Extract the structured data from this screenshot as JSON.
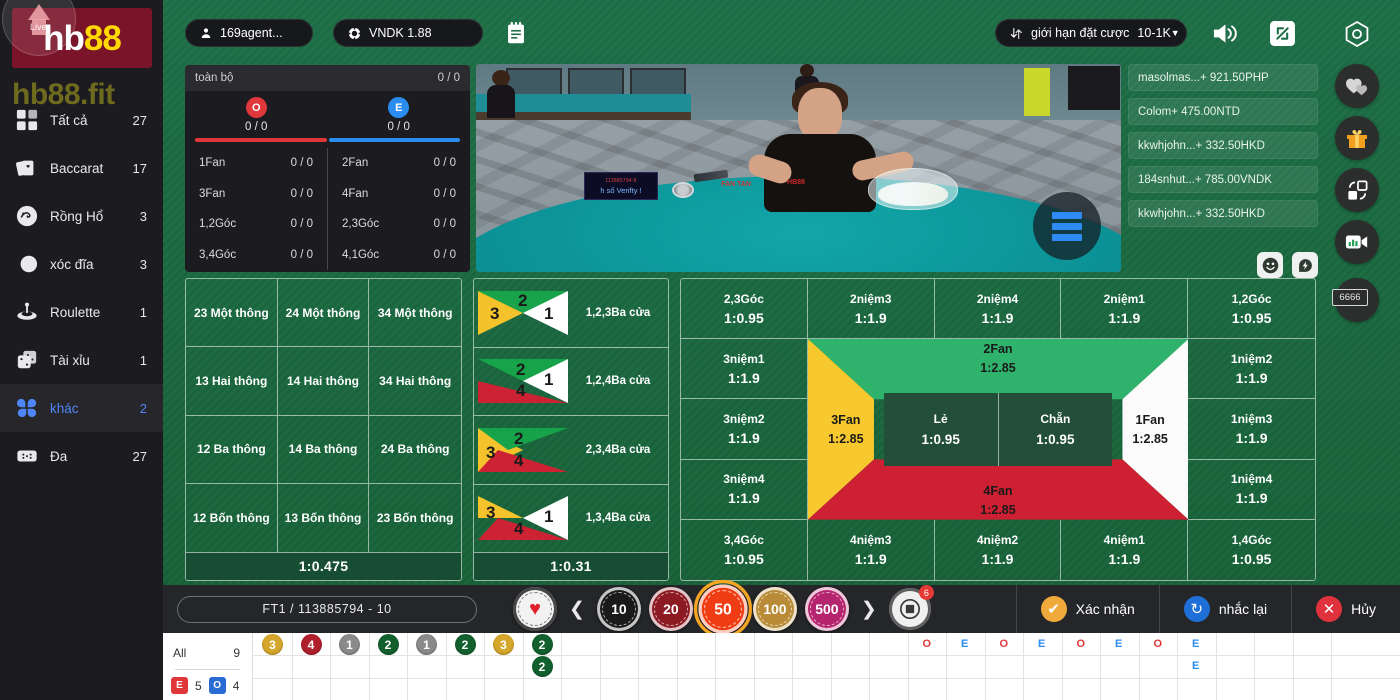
{
  "sidebar": {
    "logo_hb": "hb",
    "logo_88": "88",
    "logo_mini": "Live",
    "domain": "hb88.fit",
    "items": [
      {
        "label": "Tất cả",
        "count": "27",
        "icon": "grid-icon"
      },
      {
        "label": "Baccarat",
        "count": "17",
        "icon": "cards-icon"
      },
      {
        "label": "Rồng Hổ",
        "count": "3",
        "icon": "dragon-tiger-icon"
      },
      {
        "label": "xóc đĩa",
        "count": "3",
        "icon": "coins-icon"
      },
      {
        "label": "Roulette",
        "count": "1",
        "icon": "roulette-icon"
      },
      {
        "label": "Tài xỉu",
        "count": "1",
        "icon": "dice-icon"
      },
      {
        "label": "khác",
        "count": "2",
        "icon": "clover-icon"
      },
      {
        "label": "Đa",
        "count": "27",
        "icon": "multi-icon"
      }
    ],
    "active_index": 6
  },
  "topbar": {
    "user": "169agent...",
    "currency": "VNDK 1.88",
    "limit_label": "giới hạn đặt cược",
    "limit_value": "10-1K",
    "notes_icon": "notes-icon",
    "sound_icon": "speaker-icon",
    "expand_icon": "fullscreen-icon"
  },
  "rail": {
    "settings_icon": "settings-hex-icon",
    "favorite_icon": "hearts-icon",
    "gift_icon": "gift-icon",
    "share_icon": "share-icon",
    "stats_icon": "video-stats-icon",
    "table_badge": "6666"
  },
  "stats": {
    "title": "toàn bộ",
    "total": "0 / 0",
    "odd_badge": "O",
    "even_badge": "E",
    "odd_value": "0 / 0",
    "even_value": "0 / 0",
    "left_rows": [
      {
        "label": "1Fan",
        "value": "0 / 0"
      },
      {
        "label": "3Fan",
        "value": "0 / 0"
      },
      {
        "label": "1,2Góc",
        "value": "0 / 0"
      },
      {
        "label": "3,4Góc",
        "value": "0 / 0"
      }
    ],
    "right_rows": [
      {
        "label": "2Fan",
        "value": "0 / 0"
      },
      {
        "label": "4Fan",
        "value": "0 / 0"
      },
      {
        "label": "2,3Góc",
        "value": "0 / 0"
      },
      {
        "label": "4,1Góc",
        "value": "0 / 0"
      }
    ]
  },
  "video": {
    "board_line1": "113885794-9",
    "board_line2": "h số    Verifty !",
    "logo_left": "FAN TAN",
    "logo_right": "HB88",
    "menu_icon": "stack-menu-icon"
  },
  "feed": {
    "rows": [
      "masolmas...+ 921.50PHP",
      "Colom+ 475.00NTD",
      "kkwhjohn...+ 332.50HKD",
      "184snhut...+ 785.00VNDK",
      "kkwhjohn...+ 332.50HKD"
    ],
    "emoji_icon": "smiley-icon",
    "bolt_icon": "bolt-icon"
  },
  "board": {
    "thong": {
      "cells": [
        "23 Một thông",
        "24 Một thông",
        "34 Một thông",
        "13 Hai thông",
        "14 Hai thông",
        "34 Hai thông",
        "12 Ba thông",
        "14 Ba thông",
        "24 Ba thông",
        "12 Bốn thông",
        "13 Bốn thông",
        "23 Bốn thông"
      ],
      "odds": "1:0.475"
    },
    "bacua": {
      "rows": [
        {
          "label": "1,2,3Ba cửa",
          "nums": [
            "3",
            "2",
            "1"
          ],
          "colors": [
            "#f4c22b",
            "#16a34a",
            "#ffffff"
          ],
          "shape": "left-top-right"
        },
        {
          "label": "1,2,4Ba cửa",
          "nums": [
            "2",
            "4",
            "1"
          ],
          "colors": [
            "#16a34a",
            "#cc2233",
            "#ffffff"
          ],
          "shape": "top-bottom-right"
        },
        {
          "label": "2,3,4Ba cửa",
          "nums": [
            "3",
            "2",
            "4"
          ],
          "colors": [
            "#f4c22b",
            "#16a34a",
            "#cc2233"
          ],
          "shape": "left-top-bottom"
        },
        {
          "label": "1,3,4Ba cửa",
          "nums": [
            "3",
            "4",
            "1"
          ],
          "colors": [
            "#f4c22b",
            "#cc2233",
            "#ffffff"
          ],
          "shape": "left-bottom-right"
        }
      ],
      "odds": "1:0.31"
    },
    "main_grid": [
      {
        "label": "2,3Góc",
        "odds": "1:0.95"
      },
      {
        "label": "2niệm3",
        "odds": "1:1.9"
      },
      {
        "label": "2niệm4",
        "odds": "1:1.9"
      },
      {
        "label": "2niệm1",
        "odds": "1:1.9"
      },
      {
        "label": "1,2Góc",
        "odds": "1:0.95"
      },
      {
        "label": "3niệm1",
        "odds": "1:1.9"
      },
      {
        "label": "",
        "odds": ""
      },
      {
        "label": "",
        "odds": ""
      },
      {
        "label": "",
        "odds": ""
      },
      {
        "label": "1niệm2",
        "odds": "1:1.9"
      },
      {
        "label": "3niệm2",
        "odds": "1:1.9"
      },
      {
        "label": "",
        "odds": ""
      },
      {
        "label": "",
        "odds": ""
      },
      {
        "label": "",
        "odds": ""
      },
      {
        "label": "1niệm3",
        "odds": "1:1.9"
      },
      {
        "label": "3niệm4",
        "odds": "1:1.9"
      },
      {
        "label": "",
        "odds": ""
      },
      {
        "label": "",
        "odds": ""
      },
      {
        "label": "",
        "odds": ""
      },
      {
        "label": "1niệm4",
        "odds": "1:1.9"
      },
      {
        "label": "3,4Góc",
        "odds": "1:0.95"
      },
      {
        "label": "4niệm3",
        "odds": "1:1.9"
      },
      {
        "label": "4niệm2",
        "odds": "1:1.9"
      },
      {
        "label": "4niệm1",
        "odds": "1:1.9"
      },
      {
        "label": "1,4Góc",
        "odds": "1:0.95"
      }
    ],
    "diamond": {
      "top": {
        "label": "2Fan",
        "odds": "1:2.85",
        "color": "#2fb26b"
      },
      "left": {
        "label": "3Fan",
        "odds": "1:2.85",
        "color": "#f7c92e"
      },
      "right": {
        "label": "1Fan",
        "odds": "1:2.85",
        "color": "#fbfbfb"
      },
      "bottom": {
        "label": "4Fan",
        "odds": "1:2.85",
        "color": "#cd2033"
      },
      "center_left": {
        "label": "Lẻ",
        "odds": "1:0.95"
      },
      "center_right": {
        "label": "Chẵn",
        "odds": "1:0.95"
      }
    }
  },
  "bottom": {
    "round": "FT1  /   113885794 - 10",
    "heart_chip_icon": "heart-chip-icon",
    "prev_icon": "chevron-left-icon",
    "next_icon": "chevron-right-icon",
    "chips": [
      {
        "value": "10",
        "color": "#1a1a1a",
        "selected": false
      },
      {
        "value": "20",
        "color": "#8c1a23",
        "selected": false
      },
      {
        "value": "50",
        "color": "#f03c12",
        "selected": true
      },
      {
        "value": "100",
        "color": "#b98b36",
        "selected": false
      },
      {
        "value": "500",
        "color": "#b5246e",
        "selected": false
      }
    ],
    "more_badge": "6",
    "more_icon": "more-chips-icon",
    "actions": [
      {
        "label": "Xác nhận",
        "icon": "check-icon",
        "kind": "confirm"
      },
      {
        "label": "nhắc lại",
        "icon": "repeat-icon",
        "kind": "repeat"
      },
      {
        "label": "Hủy",
        "icon": "x-icon",
        "kind": "cancel"
      }
    ]
  },
  "roadmap": {
    "all_label": "All",
    "all_count": "9",
    "even_label": "E",
    "even_count": "5",
    "odd_label": "O",
    "odd_count": "4",
    "beads": [
      {
        "col": 0,
        "row": 0,
        "value": "3",
        "color": "#d4a62a"
      },
      {
        "col": 1,
        "row": 0,
        "value": "4",
        "color": "#b01f2c"
      },
      {
        "col": 2,
        "row": 0,
        "value": "1",
        "color": "#8a8a8a"
      },
      {
        "col": 3,
        "row": 0,
        "value": "2",
        "color": "#13602f"
      },
      {
        "col": 4,
        "row": 0,
        "value": "1",
        "color": "#8a8a8a"
      },
      {
        "col": 5,
        "row": 0,
        "value": "2",
        "color": "#13602f"
      },
      {
        "col": 6,
        "row": 0,
        "value": "3",
        "color": "#d4a62a"
      },
      {
        "col": 7,
        "row": 0,
        "value": "2",
        "color": "#13602f"
      },
      {
        "col": 7,
        "row": 1,
        "value": "2",
        "color": "#13602f"
      }
    ],
    "oe_marks": [
      {
        "col": 0,
        "row": 0,
        "value": "O",
        "color": "#e0383a"
      },
      {
        "col": 1,
        "row": 0,
        "value": "E",
        "color": "#2b8cf0"
      },
      {
        "col": 2,
        "row": 0,
        "value": "O",
        "color": "#e0383a"
      },
      {
        "col": 3,
        "row": 0,
        "value": "E",
        "color": "#2b8cf0"
      },
      {
        "col": 4,
        "row": 0,
        "value": "O",
        "color": "#e0383a"
      },
      {
        "col": 5,
        "row": 0,
        "value": "E",
        "color": "#2b8cf0"
      },
      {
        "col": 6,
        "row": 0,
        "value": "O",
        "color": "#e0383a"
      },
      {
        "col": 7,
        "row": 0,
        "value": "E",
        "color": "#2b8cf0"
      },
      {
        "col": 7,
        "row": 1,
        "value": "E",
        "color": "#2b8cf0"
      }
    ]
  }
}
